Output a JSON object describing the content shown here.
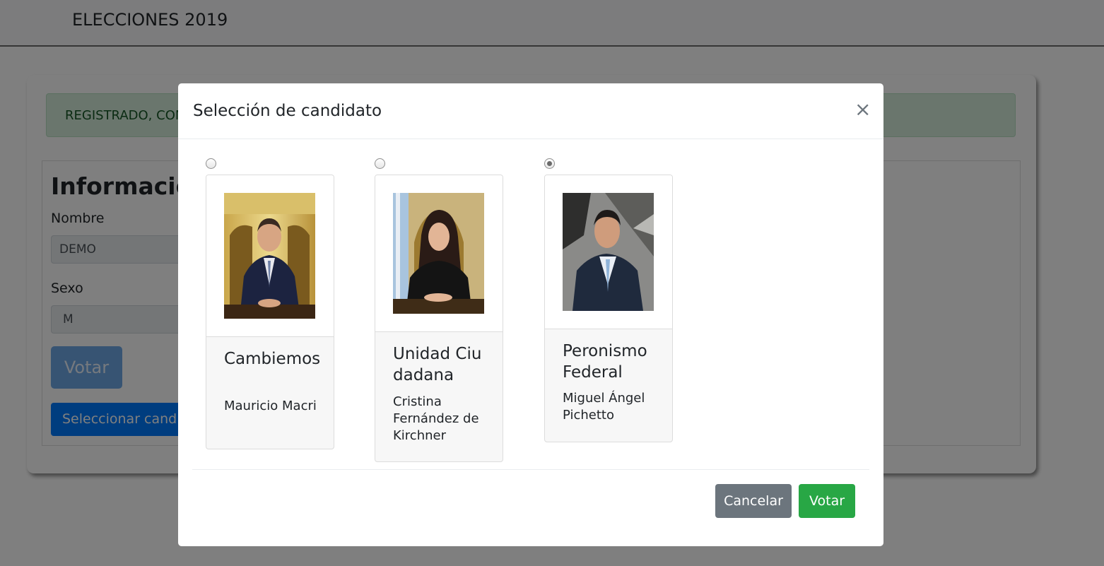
{
  "navbar": {
    "brand": "ELECCIONES 2019"
  },
  "page": {
    "alert_text": "REGISTRADO, CON",
    "info_title": "Información",
    "nombre_label": "Nombre",
    "nombre_value": "DEMO",
    "sexo_label": "Sexo",
    "sexo_value": "M",
    "votar_button": "Votar",
    "seleccionar_button": "Seleccionar candidato"
  },
  "modal": {
    "title": "Selección de candidato",
    "close_symbol": "×",
    "selected_candidate": "Peronismo Federal",
    "candidates": [
      {
        "party": "Cambiemos",
        "name": "Mauricio Macri",
        "checked": false
      },
      {
        "party": "Unidad Ciudadana",
        "name": "Cristina Fernández de Kirchner",
        "checked": false
      },
      {
        "party": "Peronismo Federal",
        "name": "Miguel Ángel Pichetto",
        "checked": true
      }
    ],
    "cancel_label": "Cancelar",
    "vote_label": "Votar"
  },
  "colors": {
    "primary": "#007bff",
    "success": "#28a745",
    "secondary": "#6c757d",
    "alert_bg": "#d4edda"
  }
}
